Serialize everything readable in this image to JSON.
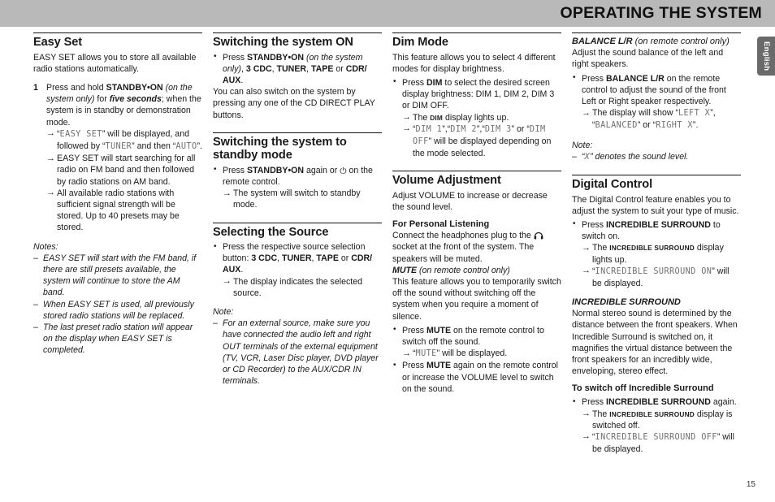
{
  "header": {
    "title": "OPERATING THE SYSTEM",
    "band_color": "#b9b9b9",
    "language_tab": "English",
    "language_tab_color": "#6a6a6a"
  },
  "page_number": "15",
  "columns": [
    {
      "id": "column-1",
      "sections": [
        {
          "id": "easy-set",
          "heading": "Easy Set",
          "intro": "EASY SET allows you to store all available radio stations automatically.",
          "steps": [
            {
              "number": "1",
              "text_parts": [
                {
                  "style": "normal",
                  "text": "Press and hold "
                },
                {
                  "style": "bold",
                  "text": "STANDBY•ON"
                },
                {
                  "style": "italic",
                  "text": " (on the system only)"
                },
                {
                  "style": "normal",
                  "text": " for "
                },
                {
                  "style": "bolditalic",
                  "text": "five seconds"
                },
                {
                  "style": "normal",
                  "text": "; when the system is in standby or demonstration mode."
                }
              ],
              "arrows": [
                [
                  {
                    "style": "normal",
                    "text": "“"
                  },
                  {
                    "style": "lcd",
                    "text": "EASY SET"
                  },
                  {
                    "style": "normal",
                    "text": "” will be displayed, and followed by “"
                  },
                  {
                    "style": "lcd",
                    "text": "TUNER"
                  },
                  {
                    "style": "normal",
                    "text": "” and then “"
                  },
                  {
                    "style": "lcd",
                    "text": "AUTO"
                  },
                  {
                    "style": "normal",
                    "text": "”."
                  }
                ],
                [
                  {
                    "style": "normal",
                    "text": "EASY SET will start searching for all radio on FM band and then followed by radio stations on AM band."
                  }
                ],
                [
                  {
                    "style": "normal",
                    "text": "All available radio stations with sufficient signal strength will be stored. Up to 40 presets may be stored."
                  }
                ]
              ]
            }
          ],
          "notes_label": "Notes:",
          "notes": [
            "EASY SET will start with the FM band, if there are still presets available, the system will continue to store the AM band.",
            "When EASY SET is used, all previously stored radio stations will be replaced.",
            "The last preset radio station will appear on the display when EASY SET is completed."
          ]
        }
      ]
    },
    {
      "id": "column-2",
      "sections": [
        {
          "id": "switching-on",
          "heading": "Switching the system ON",
          "bullets": [
            {
              "text_parts": [
                {
                  "style": "normal",
                  "text": "Press "
                },
                {
                  "style": "bold",
                  "text": "STANDBY•ON"
                },
                {
                  "style": "italic",
                  "text": " (on the system only)"
                },
                {
                  "style": "normal",
                  "text": ", "
                },
                {
                  "style": "bold",
                  "text": "3 CDC"
                },
                {
                  "style": "normal",
                  "text": ", "
                },
                {
                  "style": "bold",
                  "text": "TUNER"
                },
                {
                  "style": "normal",
                  "text": ", "
                },
                {
                  "style": "bold",
                  "text": "TAPE"
                },
                {
                  "style": "normal",
                  "text": " or "
                },
                {
                  "style": "bold",
                  "text": "CDR/ AUX"
                },
                {
                  "style": "normal",
                  "text": "."
                }
              ]
            }
          ],
          "outro": "You can also switch on the system by pressing any one of the CD DIRECT PLAY buttons."
        },
        {
          "id": "switching-standby",
          "heading": "Switching the system to standby mode",
          "bullets": [
            {
              "text_parts": [
                {
                  "style": "normal",
                  "text": "Press "
                },
                {
                  "style": "bold",
                  "text": "STANDBY•ON"
                },
                {
                  "style": "normal",
                  "text": " again or "
                },
                {
                  "style": "power-icon",
                  "text": "⏻"
                },
                {
                  "style": "normal",
                  "text": " on the remote control."
                }
              ],
              "arrows": [
                [
                  {
                    "style": "normal",
                    "text": "The system will switch to standby mode."
                  }
                ]
              ]
            }
          ]
        },
        {
          "id": "selecting-source",
          "heading": "Selecting the Source",
          "bullets": [
            {
              "text_parts": [
                {
                  "style": "normal",
                  "text": "Press the respective source selection button: "
                },
                {
                  "style": "bold",
                  "text": "3 CDC"
                },
                {
                  "style": "normal",
                  "text": ", "
                },
                {
                  "style": "bold",
                  "text": "TUNER"
                },
                {
                  "style": "normal",
                  "text": ", "
                },
                {
                  "style": "bold",
                  "text": "TAPE"
                },
                {
                  "style": "normal",
                  "text": " or "
                },
                {
                  "style": "bold",
                  "text": "CDR/ AUX"
                },
                {
                  "style": "normal",
                  "text": "."
                }
              ],
              "arrows": [
                [
                  {
                    "style": "normal",
                    "text": "The display indicates the selected source."
                  }
                ]
              ]
            }
          ],
          "notes_label": "Note:",
          "notes": [
            "For an external source, make sure you have connected the audio left and right OUT terminals of the external equipment (TV, VCR, Laser Disc player, DVD player or CD Recorder) to the AUX/CDR IN terminals."
          ]
        }
      ]
    },
    {
      "id": "column-3",
      "sections": [
        {
          "id": "dim-mode",
          "heading": "Dim Mode",
          "intro": "This feature allows you to select 4 different modes for display brightness.",
          "bullets": [
            {
              "text_parts": [
                {
                  "style": "normal",
                  "text": "Press "
                },
                {
                  "style": "bold",
                  "text": "DIM"
                },
                {
                  "style": "normal",
                  "text": " to select the desired screen display brightness: DIM 1, DIM 2, DIM 3 or DIM OFF."
                }
              ],
              "arrows": [
                [
                  {
                    "style": "normal",
                    "text": "The "
                  },
                  {
                    "style": "smallcaps",
                    "text": "DIM"
                  },
                  {
                    "style": "normal",
                    "text": " display lights up."
                  }
                ],
                [
                  {
                    "style": "normal",
                    "text": "“"
                  },
                  {
                    "style": "lcd",
                    "text": "DIM 1"
                  },
                  {
                    "style": "normal",
                    "text": "”,“"
                  },
                  {
                    "style": "lcd",
                    "text": "DIM 2"
                  },
                  {
                    "style": "normal",
                    "text": "”,“"
                  },
                  {
                    "style": "lcd",
                    "text": "DIM 3"
                  },
                  {
                    "style": "normal",
                    "text": "” or “"
                  },
                  {
                    "style": "lcd",
                    "text": "DIM OFF"
                  },
                  {
                    "style": "normal",
                    "text": "” will be displayed depending on the mode selected."
                  }
                ]
              ]
            }
          ]
        },
        {
          "id": "volume-adjustment",
          "heading": "Volume Adjustment",
          "intro": "Adjust VOLUME to increase or decrease the sound level.",
          "subheading": "For Personal Listening",
          "sub_parts": [
            {
              "style": "normal",
              "text": "Connect the headphones plug to the "
            },
            {
              "style": "headphones-icon",
              "text": "🎧"
            },
            {
              "style": "normal",
              "text": " socket at the front of the system. The speakers will be muted."
            }
          ],
          "subheading_italic_parts": [
            {
              "style": "bolditalic",
              "text": "MUTE"
            },
            {
              "style": "italic",
              "text": " (on remote control only)"
            }
          ],
          "mute_intro": "This feature allows you to temporarily switch off the sound without switching off the system when you require a moment of silence.",
          "bullets2": [
            {
              "text_parts": [
                {
                  "style": "normal",
                  "text": "Press "
                },
                {
                  "style": "bold",
                  "text": "MUTE"
                },
                {
                  "style": "normal",
                  "text": " on the remote control to switch off the sound."
                }
              ],
              "arrows": [
                [
                  {
                    "style": "normal",
                    "text": "“"
                  },
                  {
                    "style": "lcd",
                    "text": "MUTE"
                  },
                  {
                    "style": "normal",
                    "text": "” will be displayed."
                  }
                ]
              ]
            },
            {
              "text_parts": [
                {
                  "style": "normal",
                  "text": "Press "
                },
                {
                  "style": "bold",
                  "text": "MUTE"
                },
                {
                  "style": "normal",
                  "text": " again on the remote control or increase the VOLUME level to switch on the sound."
                }
              ]
            }
          ]
        }
      ]
    },
    {
      "id": "column-4",
      "sections": [
        {
          "id": "balance-lr",
          "heading_parts": [
            {
              "style": "bolditalic",
              "text": "BALANCE L/R"
            },
            {
              "style": "italic",
              "text": " (on remote control only)"
            }
          ],
          "intro": "Adjust the sound balance of the left and right speakers.",
          "bullets": [
            {
              "text_parts": [
                {
                  "style": "normal",
                  "text": "Press "
                },
                {
                  "style": "bold",
                  "text": "BALANCE L/R"
                },
                {
                  "style": "normal",
                  "text": " on the remote control to adjust the sound of the front Left or Right speaker respectively."
                }
              ],
              "arrows": [
                [
                  {
                    "style": "normal",
                    "text": "The display will show “"
                  },
                  {
                    "style": "lcd",
                    "text": "LEFT X"
                  },
                  {
                    "style": "normal",
                    "text": "”, “"
                  },
                  {
                    "style": "lcd",
                    "text": "BALANCED"
                  },
                  {
                    "style": "normal",
                    "text": "” or “"
                  },
                  {
                    "style": "lcd",
                    "text": "RIGHT X"
                  },
                  {
                    "style": "normal",
                    "text": "”."
                  }
                ]
              ]
            }
          ],
          "notes_label": "Note:",
          "notes_parts": [
            [
              {
                "style": "italic",
                "text": "“"
              },
              {
                "style": "lcd-italic",
                "text": "X"
              },
              {
                "style": "italic",
                "text": "” denotes the sound level."
              }
            ]
          ]
        },
        {
          "id": "digital-control",
          "heading": "Digital Control",
          "intro": "The Digital Control feature enables you to adjust the system to suit your type of music.",
          "subheading_italic": "INCREDIBLE SURROUND",
          "sub_intro": "Normal stereo sound is determined by the distance between the front speakers. When Incredible Surround is switched on, it magnifies the virtual distance between the front speakers for an incredibly wide, enveloping, stereo effect.",
          "bullets": [
            {
              "text_parts": [
                {
                  "style": "normal",
                  "text": "Press "
                },
                {
                  "style": "bold",
                  "text": "INCREDIBLE SURROUND"
                },
                {
                  "style": "normal",
                  "text": " to switch on."
                }
              ],
              "arrows": [
                [
                  {
                    "style": "normal",
                    "text": "The "
                  },
                  {
                    "style": "smallcaps",
                    "text": "INCREDIBLE SURROUND"
                  },
                  {
                    "style": "normal",
                    "text": " display lights up."
                  }
                ],
                [
                  {
                    "style": "normal",
                    "text": "“"
                  },
                  {
                    "style": "lcd",
                    "text": "INCREDIBLE SURROUND ON"
                  },
                  {
                    "style": "normal",
                    "text": "” will be displayed."
                  }
                ]
              ]
            }
          ],
          "subheading2": "To switch off Incredible Surround",
          "bullets2": [
            {
              "text_parts": [
                {
                  "style": "normal",
                  "text": "Press "
                },
                {
                  "style": "bold",
                  "text": "INCREDIBLE SURROUND"
                },
                {
                  "style": "normal",
                  "text": " again."
                }
              ],
              "arrows": [
                [
                  {
                    "style": "normal",
                    "text": "The "
                  },
                  {
                    "style": "smallcaps",
                    "text": "INCREDIBLE SURROUND"
                  },
                  {
                    "style": "normal",
                    "text": " display is switched off."
                  }
                ],
                [
                  {
                    "style": "normal",
                    "text": "“"
                  },
                  {
                    "style": "lcd",
                    "text": "INCREDIBLE SURROUND OFF"
                  },
                  {
                    "style": "normal",
                    "text": "” will be displayed."
                  }
                ]
              ]
            }
          ]
        }
      ]
    }
  ]
}
